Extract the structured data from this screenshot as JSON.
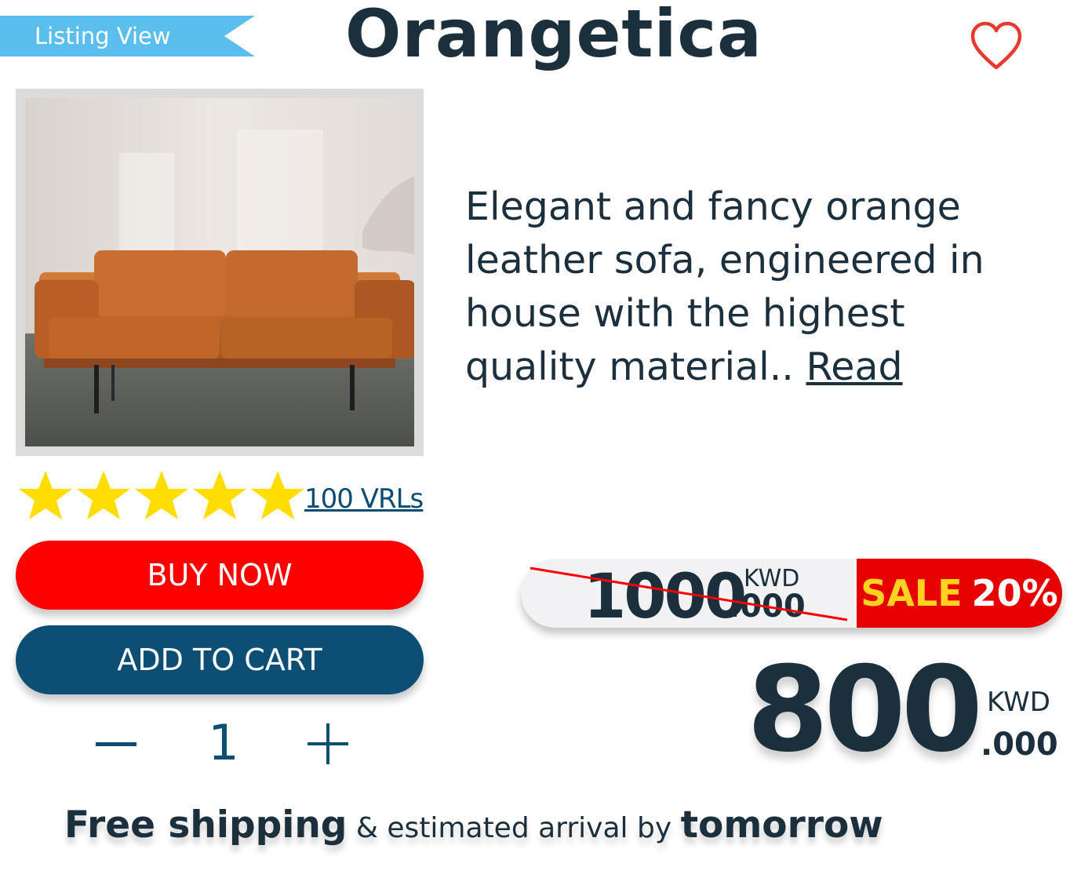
{
  "header": {
    "ribbon_label": "Listing View",
    "brand": "Orangetica",
    "favorite_icon": "heart-outline-icon"
  },
  "product": {
    "image_alt": "orange leather sofa photo",
    "description": "Elegant and fancy orange leather sofa, engineered in house with the highest quality material.. ",
    "read_more_label": "Read"
  },
  "rating": {
    "stars": 5,
    "max_stars": 5,
    "reviews_label": "100 VRLs",
    "star_color": "#ffdd00"
  },
  "actions": {
    "buy_now_label": "BUY NOW",
    "add_to_cart_label": "ADD TO CART",
    "buy_color": "#ff0000",
    "cart_color": "#0d4e74"
  },
  "quantity": {
    "minus_icon": "minus-icon",
    "value": "1",
    "plus_icon": "plus-icon"
  },
  "pricing": {
    "old_int": "1000",
    "old_dec": ".000",
    "old_currency": "KWD",
    "sale_word": "SALE",
    "sale_percent": "20%",
    "new_int": "800",
    "new_dec": ".000",
    "new_currency": "KWD"
  },
  "shipping": {
    "lead": "Free shipping",
    "middle": " & estimated arrival by ",
    "when": "tomorrow"
  }
}
